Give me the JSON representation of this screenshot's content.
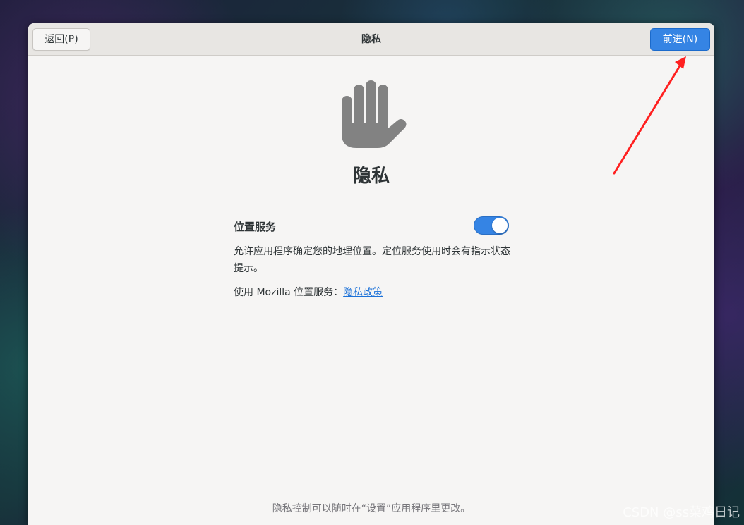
{
  "header": {
    "back_label": "返回(P)",
    "title": "隐私",
    "next_label": "前进(N)"
  },
  "main": {
    "heading": "隐私",
    "icon": "hand-stop-icon",
    "location_services": {
      "label": "位置服务",
      "enabled": true,
      "description": "允许应用程序确定您的地理位置。定位服务使用时会有指示状态提示。",
      "mozilla_prefix": "使用 Mozilla 位置服务：",
      "policy_link": "隐私政策"
    },
    "footer_note": "隐私控制可以随时在“设置”应用程序里更改。"
  },
  "watermark": "CSDN @ss菜鸡日记",
  "colors": {
    "accent": "#3584e4",
    "link": "#1c71d8",
    "annotation_arrow": "#ff2020"
  }
}
